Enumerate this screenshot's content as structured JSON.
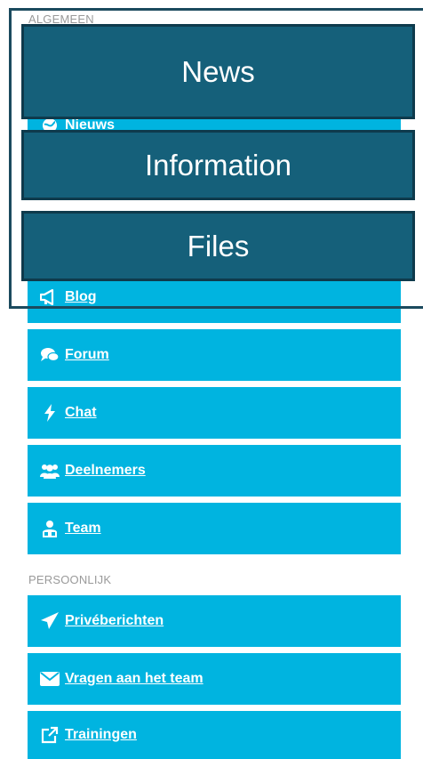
{
  "sections": {
    "algemeen": "ALGEMEEN",
    "persoonlijk": "PERSOONLIJK"
  },
  "nav": {
    "nieuws": {
      "label": "Nieuws",
      "icon": "globe-icon"
    },
    "blog": {
      "label": "Blog",
      "icon": "megaphone-icon"
    },
    "forum": {
      "label": "Forum",
      "icon": "chat-bubbles-icon"
    },
    "chat": {
      "label": "Chat",
      "icon": "bolt-icon"
    },
    "deelnemers": {
      "label": "Deelnemers",
      "icon": "users-icon"
    },
    "team": {
      "label": "Team",
      "icon": "team-icon"
    },
    "priveberichten": {
      "label": "Privéberichten",
      "icon": "paper-plane-icon"
    },
    "vragen": {
      "label": "Vragen aan het team",
      "icon": "envelope-icon"
    },
    "trainingen": {
      "label": "Trainingen",
      "icon": "external-link-icon"
    }
  },
  "overlay": {
    "news": "News",
    "information": "Information",
    "files": "Files"
  },
  "colors": {
    "item_bg": "#00b4e0",
    "overlay_bg": "#15607a",
    "overlay_border": "#0e3a4c"
  }
}
